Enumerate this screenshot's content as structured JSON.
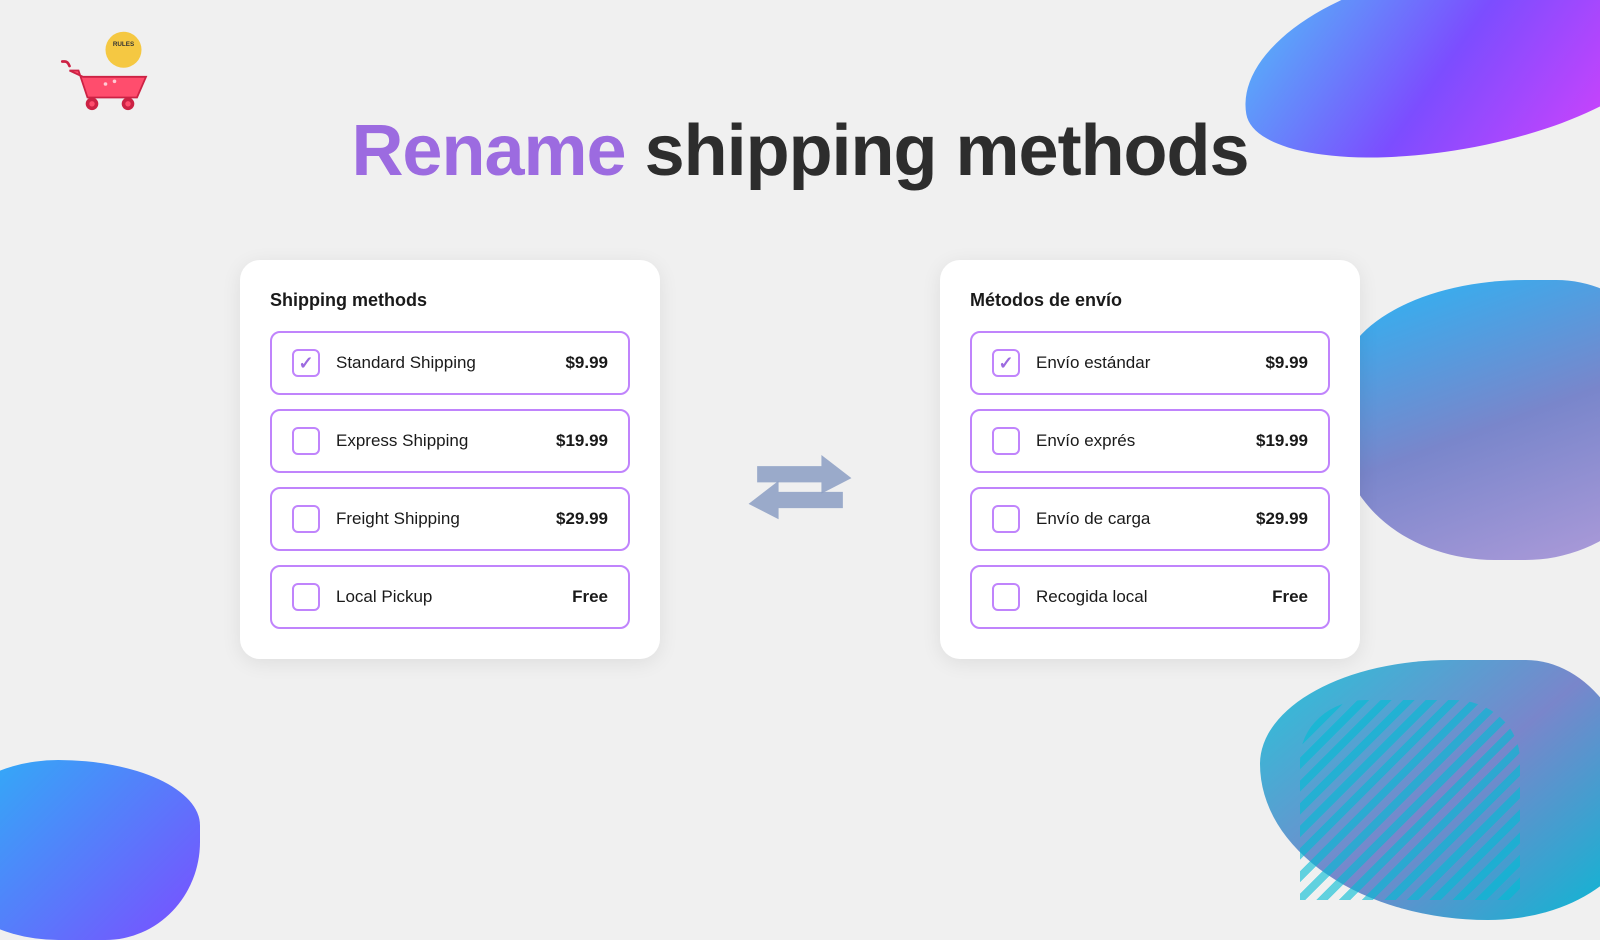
{
  "logo": {
    "badge": "RULES"
  },
  "title": {
    "rename": "Rename",
    "rest": " shipping methods"
  },
  "left_card": {
    "heading": "Shipping methods",
    "options": [
      {
        "name": "Standard Shipping",
        "price": "$9.99",
        "checked": true
      },
      {
        "name": "Express Shipping",
        "price": "$19.99",
        "checked": false
      },
      {
        "name": "Freight Shipping",
        "price": "$29.99",
        "checked": false
      },
      {
        "name": "Local Pickup",
        "price": "Free",
        "checked": false
      }
    ]
  },
  "right_card": {
    "heading": "Métodos de envío",
    "options": [
      {
        "name": "Envío estándar",
        "price": "$9.99",
        "checked": true
      },
      {
        "name": "Envío exprés",
        "price": "$19.99",
        "checked": false
      },
      {
        "name": "Envío de carga",
        "price": "$29.99",
        "checked": false
      },
      {
        "name": "Recogida local",
        "price": "Free",
        "checked": false
      }
    ]
  },
  "colors": {
    "accent_purple": "#9c6be0",
    "border_purple": "#c084fc",
    "dark_text": "#2d2d2d",
    "card_bg": "#ffffff"
  }
}
